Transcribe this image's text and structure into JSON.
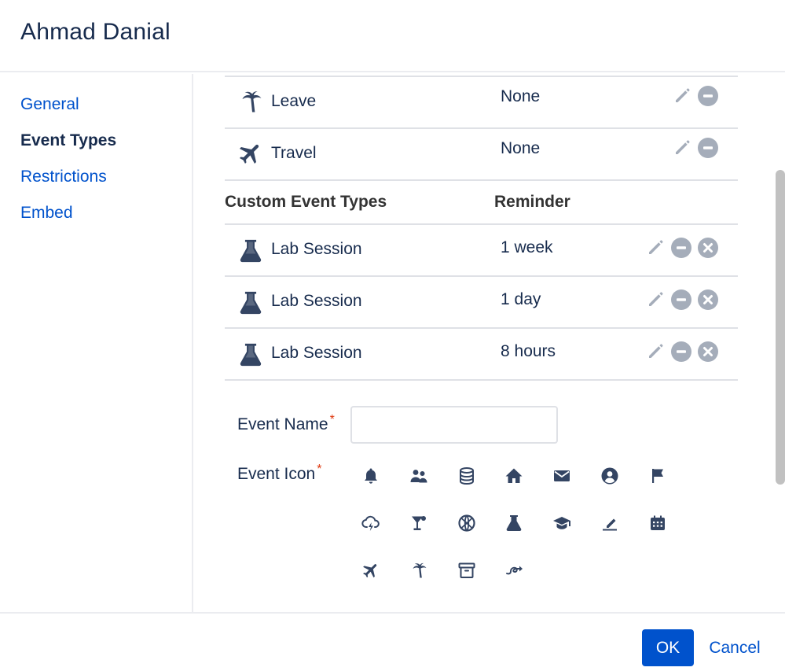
{
  "dialog": {
    "title": "Ahmad Danial"
  },
  "sidebar": {
    "items": [
      {
        "label": "General",
        "active": false
      },
      {
        "label": "Event Types",
        "active": true
      },
      {
        "label": "Restrictions",
        "active": false
      },
      {
        "label": "Embed",
        "active": false
      }
    ]
  },
  "default_event_types": [
    {
      "icon": "palm-tree-icon",
      "name": "Leave",
      "reminder": "None"
    },
    {
      "icon": "airplane-icon",
      "name": "Travel",
      "reminder": "None"
    }
  ],
  "custom_event_types": {
    "header_name": "Custom Event Types",
    "header_reminder": "Reminder",
    "rows": [
      {
        "icon": "flask-icon",
        "name": "Lab Session",
        "reminder": "1 week"
      },
      {
        "icon": "flask-icon",
        "name": "Lab Session",
        "reminder": "1 day"
      },
      {
        "icon": "flask-icon",
        "name": "Lab Session",
        "reminder": "8 hours"
      }
    ]
  },
  "form": {
    "event_name_label": "Event Name",
    "event_name_value": "",
    "event_icon_label": "Event Icon",
    "required_marker": "*",
    "icons": [
      "bell-icon",
      "people-icon",
      "database-icon",
      "home-icon",
      "envelope-icon",
      "user-circle-icon",
      "flag-icon",
      "cloud-lightning-icon",
      "cocktail-icon",
      "basketball-icon",
      "flask-icon",
      "graduation-cap-icon",
      "signature-icon",
      "calendar-icon",
      "airplane-icon",
      "palm-tree-icon",
      "archive-icon",
      "swirl-arrow-icon"
    ]
  },
  "footer": {
    "ok_label": "OK",
    "cancel_label": "Cancel"
  },
  "colors": {
    "primary": "#0052cc",
    "text": "#172b4d",
    "icon": "#344563",
    "action_icon": "#a5adba",
    "required": "#de350b",
    "divider": "#dfe1e6"
  }
}
